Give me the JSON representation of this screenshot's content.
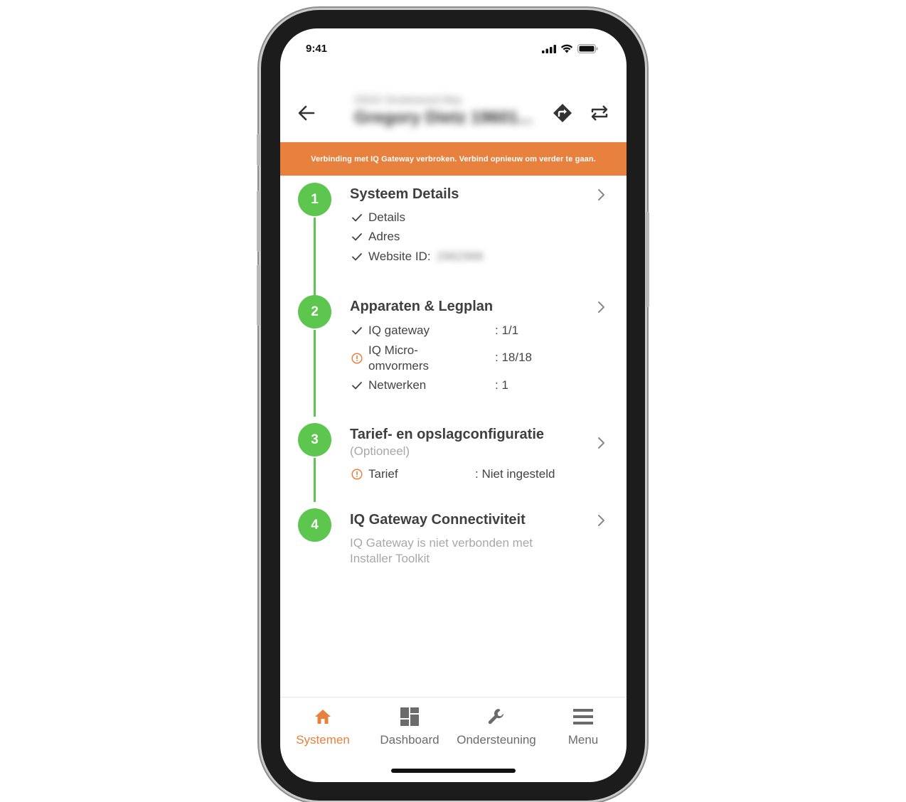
{
  "status_bar": {
    "time": "9:41"
  },
  "header": {
    "address": "25022 Smokewood Way",
    "system_name": "Gregory Dietz 19601..."
  },
  "banner": {
    "text": "Verbinding met IQ Gateway verbroken. Verbind opnieuw om verder te gaan."
  },
  "steps": [
    {
      "number": "1",
      "title": "Systeem Details",
      "items": [
        {
          "icon": "check-icon",
          "label": "Details"
        },
        {
          "icon": "check-icon",
          "label": "Adres"
        },
        {
          "icon": "check-icon",
          "label": "Website ID:",
          "value": "2982988"
        }
      ]
    },
    {
      "number": "2",
      "title": "Apparaten & Legplan",
      "items": [
        {
          "icon": "check-icon",
          "label": "IQ gateway",
          "value": ": 1/1"
        },
        {
          "icon": "warning-icon",
          "label_line1": "IQ Micro-",
          "label_line2": "omvormers",
          "value": ": 18/18"
        },
        {
          "icon": "check-icon",
          "label": "Netwerken",
          "value": ": 1"
        }
      ]
    },
    {
      "number": "3",
      "title": "Tarief- en opslagconfiguratie",
      "subtitle": "(Optioneel)",
      "items": [
        {
          "icon": "warning-icon",
          "label": "Tarief",
          "value": ": Niet ingesteld"
        }
      ]
    },
    {
      "number": "4",
      "title": "IQ Gateway Connectiviteit",
      "subtitle_line1": "IQ Gateway is niet verbonden met",
      "subtitle_line2": "Installer Toolkit"
    }
  ],
  "tabs": [
    {
      "label": "Systemen",
      "icon": "home-icon",
      "active": true
    },
    {
      "label": "Dashboard",
      "icon": "dashboard-icon",
      "active": false
    },
    {
      "label": "Ondersteuning",
      "icon": "wrench-icon",
      "active": false
    },
    {
      "label": "Menu",
      "icon": "menu-icon",
      "active": false
    }
  ],
  "colors": {
    "accent": "#e8803e",
    "step_green": "#5cc64f",
    "muted_text": "#a8a8a8"
  }
}
